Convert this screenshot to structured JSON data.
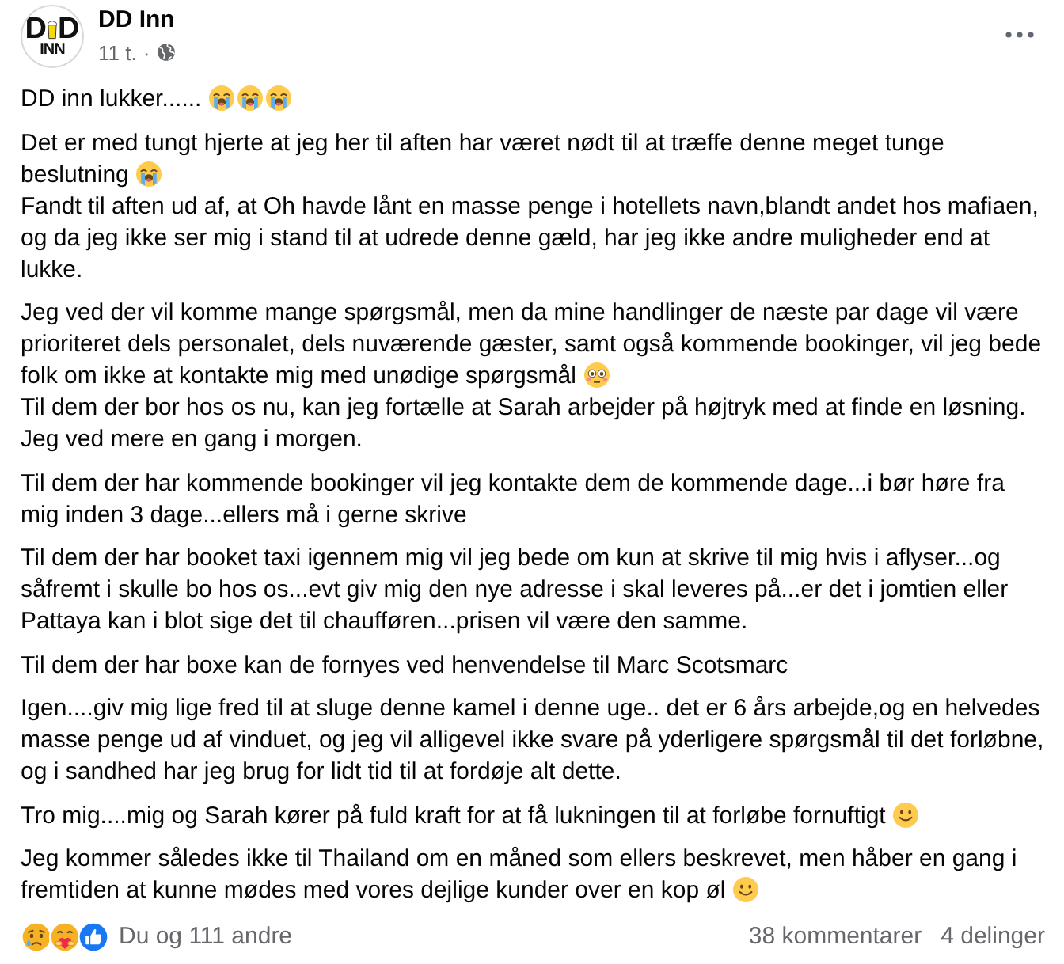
{
  "page": {
    "name": "DD Inn",
    "logo": {
      "letters": [
        "D",
        "D"
      ],
      "bottom": "INN"
    },
    "time": "11 t.",
    "separator": "·"
  },
  "paragraphs": [
    {
      "lines": [
        {
          "text": "DD inn lukker......",
          "emojis": [
            {
              "kind": "crying"
            },
            {
              "kind": "crying"
            },
            {
              "kind": "crying"
            }
          ]
        }
      ]
    },
    {
      "lines": [
        {
          "text": "Det er med tungt hjerte at jeg her til aften har været nødt til at træffe denne meget tunge"
        },
        {
          "text": "beslutning",
          "emojis": [
            {
              "kind": "crying"
            }
          ]
        },
        {
          "text": "Fandt til aften ud af, at Oh havde lånt en masse penge i hotellets navn,blandt andet hos mafiaen, og da jeg ikke ser mig i stand til at udrede denne gæld, har jeg ikke andre muligheder end at lukke."
        }
      ]
    },
    {
      "lines": [
        {
          "text": "Jeg ved der vil komme mange spørgsmål, men da mine handlinger de næste par dage vil være prioriteret dels personalet, dels nuværende gæster, samt også kommende bookinger, vil jeg bede"
        },
        {
          "text": "folk om ikke at kontakte mig med unødige spørgsmål",
          "emojis": [
            {
              "kind": "flushed"
            }
          ]
        },
        {
          "text": "Til dem der bor hos os nu, kan jeg fortælle at Sarah arbejder på højtryk med at finde en løsning."
        },
        {
          "text": "Jeg ved mere en gang i morgen."
        }
      ]
    },
    {
      "lines": [
        {
          "text": "Til dem der har kommende bookinger vil jeg kontakte dem de kommende dage...i bør høre fra mig inden 3 dage...ellers må i gerne skrive"
        }
      ]
    },
    {
      "lines": [
        {
          "text": "Til dem der har booket taxi igennem mig vil jeg bede om kun at skrive til mig hvis i aflyser...og såfremt i skulle bo hos os...evt giv mig den nye adresse i skal leveres på...er det i jomtien eller Pattaya kan i blot sige det til chaufføren...prisen vil være den samme."
        }
      ]
    },
    {
      "lines": [
        {
          "text": "Til dem der har boxe kan de fornyes ved henvendelse til Marc Scotsmarc"
        }
      ]
    },
    {
      "lines": [
        {
          "text": "Igen....giv mig lige fred til at sluge denne kamel i denne uge.. det er 6 års arbejde,og en helvedes masse penge ud af vinduet, og jeg vil alligevel ikke svare på yderligere spørgsmål til det forløbne, og i sandhed har jeg brug for lidt tid til at fordøje alt dette."
        }
      ]
    },
    {
      "lines": [
        {
          "text": "Tro mig....mig og Sarah kører på fuld kraft for at få lukningen til at forløbe fornuftigt",
          "emojis": [
            {
              "kind": "smiling"
            }
          ]
        }
      ]
    },
    {
      "lines": [
        {
          "text": "Jeg kommer således ikke til Thailand om en måned som ellers beskrevet, men håber en gang i"
        },
        {
          "text": "fremtiden at kunne mødes med vores dejlige kunder over en kop øl",
          "emojis": [
            {
              "kind": "smiling"
            }
          ]
        }
      ]
    }
  ],
  "footer": {
    "reactions": [
      {
        "kind": "sad"
      },
      {
        "kind": "care"
      },
      {
        "kind": "like"
      }
    ],
    "reaction_summary": "Du og 111 andre",
    "comments": "38 kommentarer",
    "shares": "4 delinger"
  }
}
